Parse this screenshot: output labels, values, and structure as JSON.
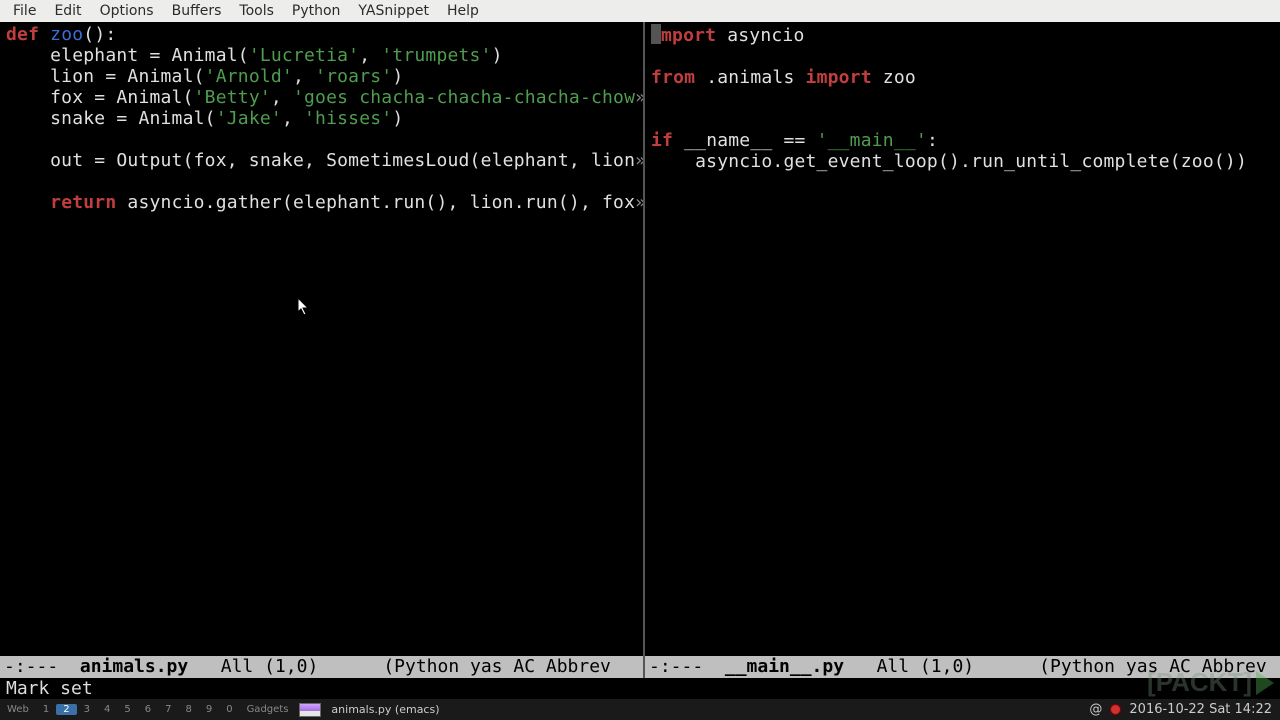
{
  "menubar": [
    "File",
    "Edit",
    "Options",
    "Buffers",
    "Tools",
    "Python",
    "YASnippet",
    "Help"
  ],
  "left": {
    "filename": "animals.py",
    "code_tokens": [
      [
        [
          "kw",
          "def"
        ],
        [
          "txt",
          " "
        ],
        [
          "fn",
          "zoo"
        ],
        [
          "txt",
          "():"
        ]
      ],
      [
        [
          "txt",
          "    elephant = Animal("
        ],
        [
          "str",
          "'Lucretia'"
        ],
        [
          "txt",
          ", "
        ],
        [
          "str",
          "'trumpets'"
        ],
        [
          "txt",
          ")"
        ]
      ],
      [
        [
          "txt",
          "    lion = Animal("
        ],
        [
          "str",
          "'Arnold'"
        ],
        [
          "txt",
          ", "
        ],
        [
          "str",
          "'roars'"
        ],
        [
          "txt",
          ")"
        ]
      ],
      [
        [
          "txt",
          "    fox = Animal("
        ],
        [
          "str",
          "'Betty'"
        ],
        [
          "txt",
          ", "
        ],
        [
          "str",
          "'goes chacha-chacha-chacha-chow"
        ],
        [
          "trunc",
          "»"
        ]
      ],
      [
        [
          "txt",
          "    snake = Animal("
        ],
        [
          "str",
          "'Jake'"
        ],
        [
          "txt",
          ", "
        ],
        [
          "str",
          "'hisses'"
        ],
        [
          "txt",
          ")"
        ]
      ],
      [
        [
          "txt",
          ""
        ]
      ],
      [
        [
          "txt",
          "    out = Output(fox, snake, SometimesLoud(elephant, lion"
        ],
        [
          "trunc",
          "»"
        ]
      ],
      [
        [
          "txt",
          ""
        ]
      ],
      [
        [
          "txt",
          "    "
        ],
        [
          "kw",
          "return"
        ],
        [
          "txt",
          " asyncio.gather(elephant.run(), lion.run(), fox"
        ],
        [
          "trunc",
          "»"
        ]
      ]
    ],
    "modeline_prefix": "-:---  ",
    "modeline_pos": "   All (1,0)      ",
    "modeline_modes": "(Python yas AC Abbrev"
  },
  "right": {
    "filename": "__main__.py",
    "code_tokens": [
      [
        [
          "kw",
          "import"
        ],
        [
          "txt",
          " asyncio"
        ]
      ],
      [
        [
          "txt",
          ""
        ]
      ],
      [
        [
          "kw",
          "from"
        ],
        [
          "txt",
          " .animals "
        ],
        [
          "kw",
          "import"
        ],
        [
          "txt",
          " zoo"
        ]
      ],
      [
        [
          "txt",
          ""
        ]
      ],
      [
        [
          "txt",
          ""
        ]
      ],
      [
        [
          "kw",
          "if"
        ],
        [
          "txt",
          " __name__ == "
        ],
        [
          "str",
          "'__main__'"
        ],
        [
          "txt",
          ":"
        ]
      ],
      [
        [
          "txt",
          "    asyncio.get_event_loop().run_until_complete(zoo())"
        ]
      ]
    ],
    "modeline_prefix": "-:---  ",
    "modeline_pos": "   All (1,0)      ",
    "modeline_modes": "(Python yas AC Abbrev"
  },
  "minibuffer": "Mark set",
  "taskbar": {
    "label_web": "Web",
    "workspaces": [
      "1",
      "2",
      "3",
      "4",
      "5",
      "6",
      "7",
      "8",
      "9",
      "0"
    ],
    "active_ws": "2",
    "label_gadgets": "Gadgets",
    "app_title": "animals.py (emacs)",
    "at_sign": "@",
    "clock": "2016-10-22 Sat 14:22"
  },
  "watermark": "[PACKT]"
}
